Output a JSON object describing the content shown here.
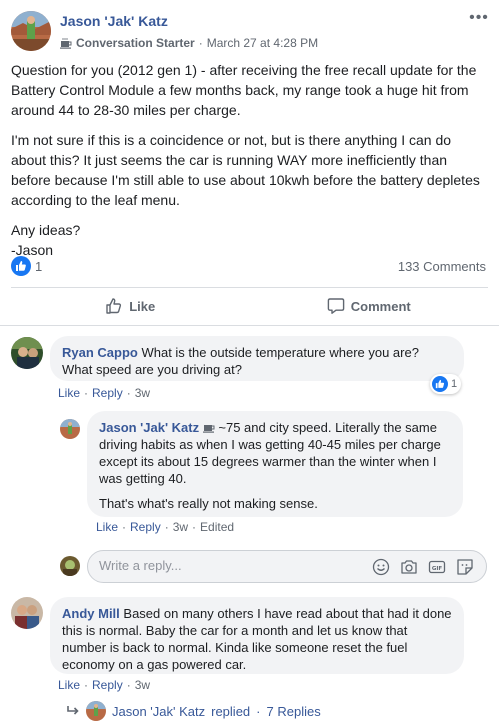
{
  "post": {
    "author": "Jason 'Jak' Katz",
    "badge": "Conversation Starter",
    "timestamp": "March 27 at 4:28 PM",
    "more_icon": "more-horizontal-icon",
    "paragraphs": [
      "Question for you (2012 gen 1) - after receiving the free recall update for the Battery Control Module a few months back, my range took a huge hit from around 44 to 28-30 miles per charge.",
      "I'm not sure if this is a coincidence or not, but is there anything I can do about this? It just seems the car is running WAY more inefficiently than before because I'm still able to use about 10kwh before the battery depletes according to the leaf menu.",
      "Any ideas?",
      "-Jason"
    ],
    "reaction_count": "1",
    "comment_count": "133 Comments"
  },
  "actions": {
    "like_label": "Like",
    "comment_label": "Comment"
  },
  "comments": {
    "c1": {
      "name": "Ryan Cappo",
      "text": "What is the outside temperature where you are? What speed are you driving at?",
      "like": "Like",
      "reply": "Reply",
      "time": "3w",
      "reactions": "1"
    },
    "r1": {
      "name": "Jason 'Jak' Katz",
      "text": "~75 and city speed. Literally the same driving habits as when I was getting 40-45 miles per charge except its about 15 degrees warmer than the winter when I was getting 40.",
      "text2": "That's what's really not making sense.",
      "like": "Like",
      "reply": "Reply",
      "time": "3w",
      "edited": "Edited"
    },
    "c2": {
      "name": "Andy Mill",
      "text": "Based on many others I have read about that had it done this is normal. Baby the car for a month and let us know that number is back to normal. Kinda like someone reset the fuel economy on a gas powered car.",
      "like": "Like",
      "reply": "Reply",
      "time": "3w"
    }
  },
  "reply_box": {
    "placeholder": "Write a reply..."
  },
  "replied": {
    "name": "Jason 'Jak' Katz",
    "suffix": "replied",
    "replies": "7 Replies"
  },
  "colors": {
    "link": "#385898",
    "like_blue": "#1877f2",
    "bubble": "#f2f3f5",
    "muted": "#606770"
  }
}
